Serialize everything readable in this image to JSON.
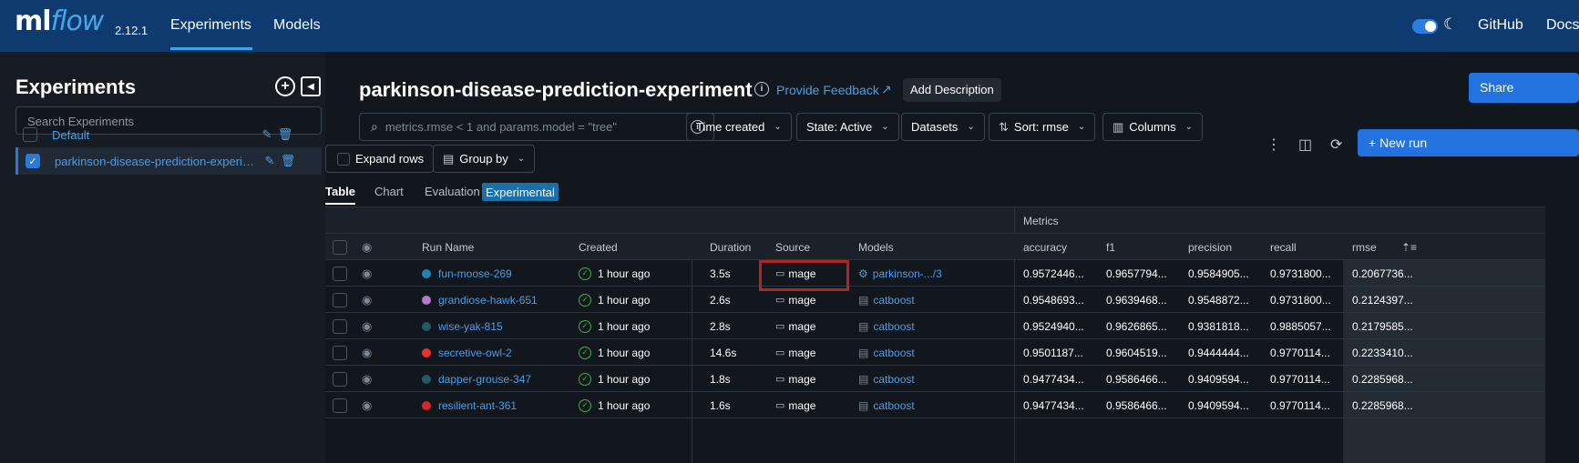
{
  "nav": {
    "logo_ml": "ml",
    "logo_flow": "flow",
    "version": "2.12.1",
    "links": [
      "Experiments",
      "Models"
    ],
    "github": "GitHub",
    "docs": "Docs",
    "accent": "#43a4e6",
    "bg": "#0e3a70"
  },
  "sidebar": {
    "title": "Experiments",
    "add_icon": "plus-circle-icon",
    "collapse_icon": "collapse-sidebar-icon",
    "search_placeholder": "Search Experiments",
    "experiments": [
      {
        "name": "Default",
        "checked": false
      },
      {
        "name": "parkinson-disease-prediction-experiment",
        "checked": true
      }
    ]
  },
  "main": {
    "title": "parkinson-disease-prediction-experiment",
    "feedback_label": "Provide Feedback",
    "add_description": "Add Description",
    "share": "Share",
    "search_placeholder": "metrics.rmse < 1 and params.model = \"tree\"",
    "controls": {
      "time_created": "Time created",
      "state": "State: Active",
      "datasets": "Datasets",
      "sort": "Sort: rmse",
      "columns": "Columns",
      "expand_rows": "Expand rows",
      "group_by": "Group by"
    },
    "new_run": "New run",
    "tabs": [
      "Table",
      "Chart",
      "Evaluation"
    ],
    "experimental_badge": "Experimental"
  },
  "table": {
    "group_header": "Metrics",
    "headers": {
      "run_name": "Run Name",
      "created": "Created",
      "duration": "Duration",
      "source": "Source",
      "models": "Models",
      "accuracy": "accuracy",
      "f1": "f1",
      "precision": "precision",
      "recall": "recall",
      "rmse": "rmse"
    },
    "rows": [
      {
        "color": "#1b84b3",
        "name": "fun-moose-269",
        "created": "1 hour ago",
        "duration": "3.5s",
        "source": "mage",
        "model": "parkinson-.../3",
        "model_icon": "model-registered-icon",
        "accuracy": "0.9572446...",
        "f1": "0.9657794...",
        "precision": "0.9584905...",
        "recall": "0.9731800...",
        "rmse": "0.2067736..."
      },
      {
        "color": "#b17bc9",
        "name": "grandiose-hawk-651",
        "created": "1 hour ago",
        "duration": "2.6s",
        "source": "mage",
        "model": "catboost",
        "model_icon": "model-file-icon",
        "accuracy": "0.9548693...",
        "f1": "0.9639468...",
        "precision": "0.9548872...",
        "recall": "0.9731800...",
        "rmse": "0.2124397..."
      },
      {
        "color": "#1e5b67",
        "name": "wise-yak-815",
        "created": "1 hour ago",
        "duration": "2.8s",
        "source": "mage",
        "model": "catboost",
        "model_icon": "model-file-icon",
        "accuracy": "0.9524940...",
        "f1": "0.9626865...",
        "precision": "0.9381818...",
        "recall": "0.9885057...",
        "rmse": "0.2179585..."
      },
      {
        "color": "#ed2e2e",
        "name": "secretive-owl-2",
        "created": "1 hour ago",
        "duration": "14.6s",
        "source": "mage",
        "model": "catboost",
        "model_icon": "model-file-icon",
        "accuracy": "0.9501187...",
        "f1": "0.9604519...",
        "precision": "0.9444444...",
        "recall": "0.9770114...",
        "rmse": "0.2233410..."
      },
      {
        "color": "#1e5b67",
        "name": "dapper-grouse-347",
        "created": "1 hour ago",
        "duration": "1.8s",
        "source": "mage",
        "model": "catboost",
        "model_icon": "model-file-icon",
        "accuracy": "0.9477434...",
        "f1": "0.9586466...",
        "precision": "0.9409594...",
        "recall": "0.9770114...",
        "rmse": "0.2285968..."
      },
      {
        "color": "#d42828",
        "name": "resilient-ant-361",
        "created": "1 hour ago",
        "duration": "1.6s",
        "source": "mage",
        "model": "catboost",
        "model_icon": "model-file-icon",
        "accuracy": "0.9477434...",
        "f1": "0.9586466...",
        "precision": "0.9409594...",
        "recall": "0.9770114...",
        "rmse": "0.2285968..."
      }
    ]
  }
}
